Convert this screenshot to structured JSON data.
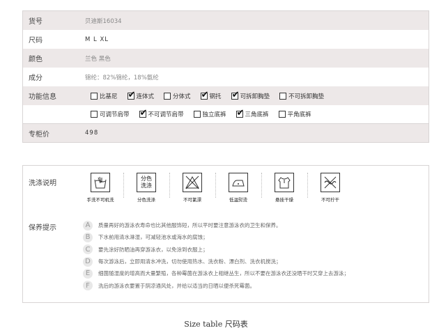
{
  "spec": {
    "rows": [
      {
        "label": "货号",
        "value": "贝迪斯16034"
      },
      {
        "label": "尺码",
        "value": "M   L   XL"
      },
      {
        "label": "颜色",
        "value": "兰色  黑色"
      },
      {
        "label": "成分",
        "value": "锦纶：82%锦纶，18%氨纶"
      },
      {
        "label": "功能信息"
      },
      {
        "label": ""
      },
      {
        "label": "专柜价",
        "value": "498"
      }
    ],
    "features_row1": [
      {
        "label": "比基尼",
        "checked": false
      },
      {
        "label": "连体式",
        "checked": true
      },
      {
        "label": "分体式",
        "checked": false
      },
      {
        "label": "钢托",
        "checked": true
      },
      {
        "label": "可拆卸胸垫",
        "checked": true
      },
      {
        "label": "不可拆卸胸垫",
        "checked": false
      }
    ],
    "features_row2": [
      {
        "label": "可调节肩带",
        "checked": false
      },
      {
        "label": "不可调节肩带",
        "checked": true
      },
      {
        "label": "独立底裤",
        "checked": false
      },
      {
        "label": "三角底裤",
        "checked": true
      },
      {
        "label": "平角底裤",
        "checked": false
      }
    ]
  },
  "care": {
    "wash_label": "洗涤说明",
    "tips_label": "保养提示",
    "icons": [
      {
        "name": "hand-wash-icon",
        "caption": "手洗不可机洗"
      },
      {
        "name": "separate-wash-icon",
        "caption": "分色洗涤",
        "text1": "分色",
        "text2": "洗涤"
      },
      {
        "name": "no-bleach-icon",
        "caption": "不可氯漂"
      },
      {
        "name": "low-iron-icon",
        "caption": "低温熨烫"
      },
      {
        "name": "hang-dry-icon",
        "caption": "悬挂干燥"
      },
      {
        "name": "no-wring-icon",
        "caption": "不可拧干"
      }
    ],
    "tips": [
      {
        "letter": "A",
        "text": "质量再好的游泳衣寿命也比其他服饰短，所以平时要注意游泳衣的卫生和保养。"
      },
      {
        "letter": "B",
        "text": "下水前用清水淋湿，可减轻池水或海水的腐蚀；"
      },
      {
        "letter": "C",
        "text": "要先涂好防晒油再穿游泳衣，以免涂到衣服上；"
      },
      {
        "letter": "D",
        "text": "每次游泳后，立即用清水冲洗，切勿使用热水、洗衣粉、漂白剂、洗衣机搅洗；"
      },
      {
        "letter": "E",
        "text": "细菌随湿度的增高而大量繁殖，各种霉菌在游泳衣上相继丛生，所以不要在游泳衣还没晒干时又穿上去游泳；"
      },
      {
        "letter": "F",
        "text": "洗后的游泳衣要置于阴凉通风处，并给以适当的日晒以便杀死霉菌。"
      }
    ]
  },
  "caption": "Size table 尺码表"
}
